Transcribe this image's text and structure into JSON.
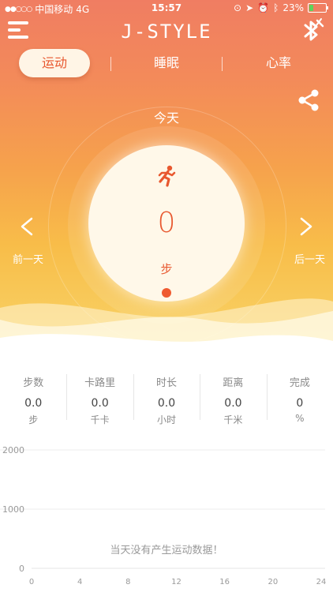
{
  "status_bar": {
    "signal": "●●○○○",
    "carrier": "中国移动",
    "network": "4G",
    "time": "15:57",
    "battery": "23%",
    "battery_level": 0.23,
    "battery_color": "#5fd35a"
  },
  "app": {
    "logo_text": "J-STYLE"
  },
  "tabs": [
    {
      "label": "运动",
      "active": true
    },
    {
      "label": "睡眠",
      "active": false
    },
    {
      "label": "心率",
      "active": false
    }
  ],
  "day": {
    "title": "今天",
    "steps_value": "0",
    "steps_unit": "步",
    "prev_label": "前一天",
    "next_label": "后一天"
  },
  "stats": [
    {
      "label": "步数",
      "value": "0.0",
      "unit": "步"
    },
    {
      "label": "卡路里",
      "value": "0.0",
      "unit": "千卡"
    },
    {
      "label": "时长",
      "value": "0.0",
      "unit": "小时"
    },
    {
      "label": "距离",
      "value": "0.0",
      "unit": "千米"
    },
    {
      "label": "完成",
      "value": "0",
      "unit": "%"
    }
  ],
  "chart": {
    "empty_message": "当天没有产生运动数据！"
  },
  "chart_data": {
    "type": "bar",
    "x_ticks": [
      "0",
      "4",
      "8",
      "12",
      "16",
      "20",
      "24"
    ],
    "y_ticks": [
      "0",
      "1000",
      "2000"
    ],
    "xlim": [
      0,
      24
    ],
    "ylim": [
      0,
      2000
    ],
    "values": []
  },
  "colors": {
    "accent": "#e8582f",
    "hero_top": "#f07d62",
    "hero_bottom": "#f9d468"
  }
}
